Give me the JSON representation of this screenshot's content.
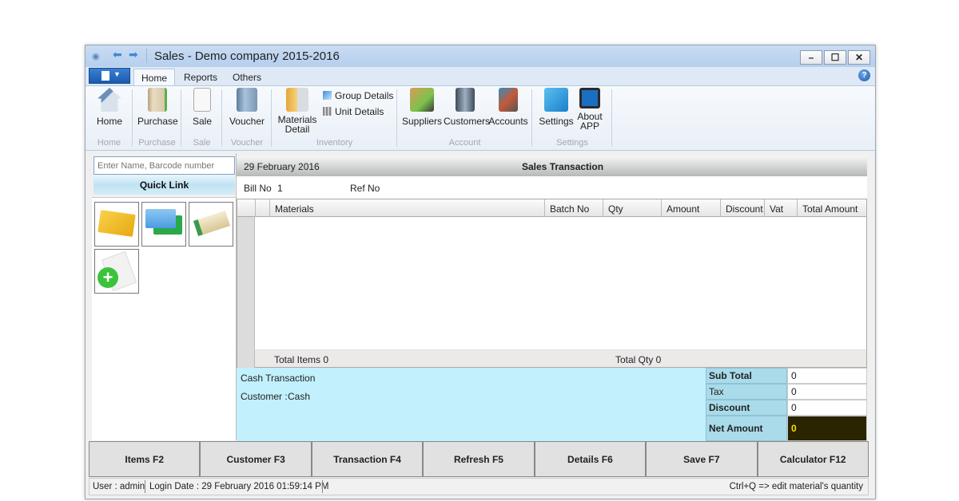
{
  "window": {
    "title": "Sales - Demo company 2015-2016",
    "controls": {
      "minimize": "–",
      "maximize": "☐",
      "close": "✕"
    },
    "help_icon": "?"
  },
  "ribbon": {
    "tabs": [
      {
        "label": "Home",
        "active": true
      },
      {
        "label": "Reports",
        "active": false
      },
      {
        "label": "Others",
        "active": false
      }
    ],
    "groups": [
      {
        "label": "Home",
        "buttons": [
          {
            "label": "Home",
            "icon": "house-icon"
          }
        ]
      },
      {
        "label": "Purchase",
        "buttons": [
          {
            "label": "Purchase",
            "icon": "notebook-icon"
          }
        ]
      },
      {
        "label": "Sale",
        "buttons": [
          {
            "label": "Sale",
            "icon": "invoice-icon"
          }
        ]
      },
      {
        "label": "Voucher",
        "buttons": [
          {
            "label": "Voucher",
            "icon": "binder-icon"
          }
        ]
      },
      {
        "label": "Inventory",
        "buttons": [
          {
            "label": "Materials Detail",
            "icon": "folder-icon"
          }
        ],
        "small_buttons": [
          {
            "label": "Group Details",
            "icon": "flag-icon"
          },
          {
            "label": "Unit Details",
            "icon": "grid-icon"
          }
        ]
      },
      {
        "label": "Account",
        "buttons": [
          {
            "label": "Suppliers",
            "icon": "handshake-icon"
          },
          {
            "label": "Customers",
            "icon": "contact-book-icon"
          },
          {
            "label": "Accounts",
            "icon": "accounts-icon"
          }
        ]
      },
      {
        "label": "Settings",
        "buttons": [
          {
            "label": "Settings",
            "icon": "tools-icon"
          },
          {
            "label": "About APP",
            "icon": "monitor-icon"
          }
        ]
      }
    ]
  },
  "left": {
    "search_placeholder": "Enter Name, Barcode number",
    "quick_link_label": "Quick Link",
    "tiles": [
      {
        "name": "cash",
        "icon": "banknotes-icon"
      },
      {
        "name": "card",
        "icon": "credit-card-icon"
      },
      {
        "name": "cheque",
        "icon": "cheque-icon"
      },
      {
        "name": "new",
        "icon": "add-document-icon"
      }
    ]
  },
  "main": {
    "date": "29 February 2016",
    "title": "Sales Transaction",
    "bill_no_label": "Bill No",
    "bill_no_value": "1",
    "ref_no_label": "Ref No",
    "ref_no_value": "",
    "columns": [
      "Materials",
      "Batch No",
      "Qty",
      "Amount",
      "Discount",
      "Vat",
      "Total Amount"
    ],
    "rows": [],
    "total_items": "Total Items 0",
    "total_qty": "Total Qty 0"
  },
  "transaction": {
    "type": "Cash Transaction",
    "customer_label": "Customer :",
    "customer_value": "Cash"
  },
  "totals": {
    "sub_total_label": "Sub Total",
    "sub_total": "0",
    "tax_label": "Tax",
    "tax": "0",
    "discount_label": "Discount",
    "discount": "0",
    "net_amount_label": "Net Amount",
    "net_amount": "0"
  },
  "function_buttons": [
    "Items F2",
    "Customer F3",
    "Transaction F4",
    "Refresh F5",
    "Details F6",
    "Save F7",
    "Calculator F12"
  ],
  "status": {
    "user": "User : admin",
    "login": "Login Date : 29 February 2016 01:59:14 PM",
    "hint": "Ctrl+Q => edit material's quantity"
  }
}
